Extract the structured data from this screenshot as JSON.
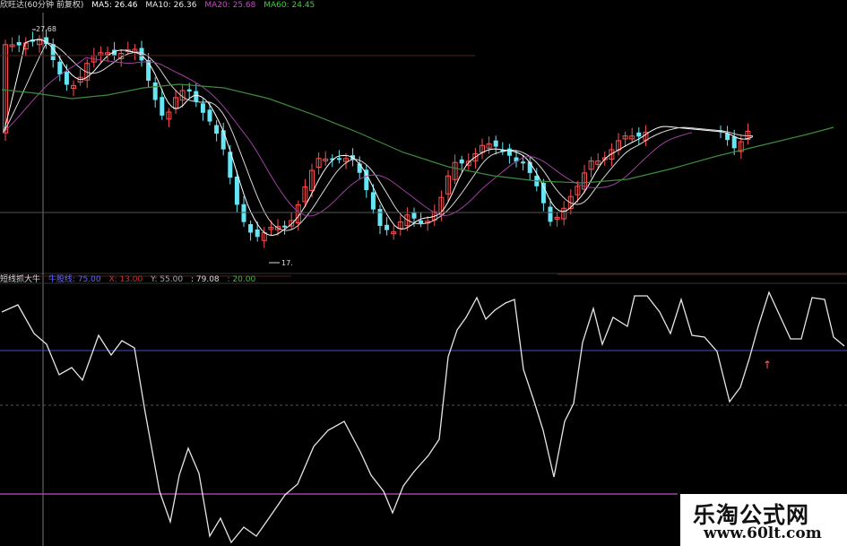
{
  "top_panel": {
    "title": "欣旺达(60分钟 前复权)",
    "indicators": [
      {
        "label": "MA5: 26.46",
        "color": "#ffffff"
      },
      {
        "label": "MA10: 26.36",
        "color": "#e8e8e8"
      },
      {
        "label": "MA20: 25.68",
        "color": "#cc44cc"
      },
      {
        "label": "MA60: 24.45",
        "color": "#44cc44"
      }
    ],
    "high_label": "27.68",
    "low_label": "17.",
    "colors": {
      "up": "#ff5050",
      "down": "#66e6f5",
      "ma5": "#ffffff",
      "ma10": "#d8d8d8",
      "ma20": "#a040a0",
      "ma60": "#3c8c3c"
    }
  },
  "bottom_panel": {
    "title": "短线抓大牛",
    "indicators": [
      {
        "label": "牛股线: 75.00",
        "color": "#5555ff"
      },
      {
        "label": "X: 13.00",
        "color": "#cc3333"
      },
      {
        "label": "Y: 55.00",
        "color": "#aaaaaa"
      },
      {
        "label": ": 79.08",
        "color": "#dddddd"
      },
      {
        "label": ": 20.00",
        "color": "#44bb44"
      }
    ]
  },
  "watermark": {
    "text": "乐淘公式网",
    "url": "www.60lt.com"
  }
}
